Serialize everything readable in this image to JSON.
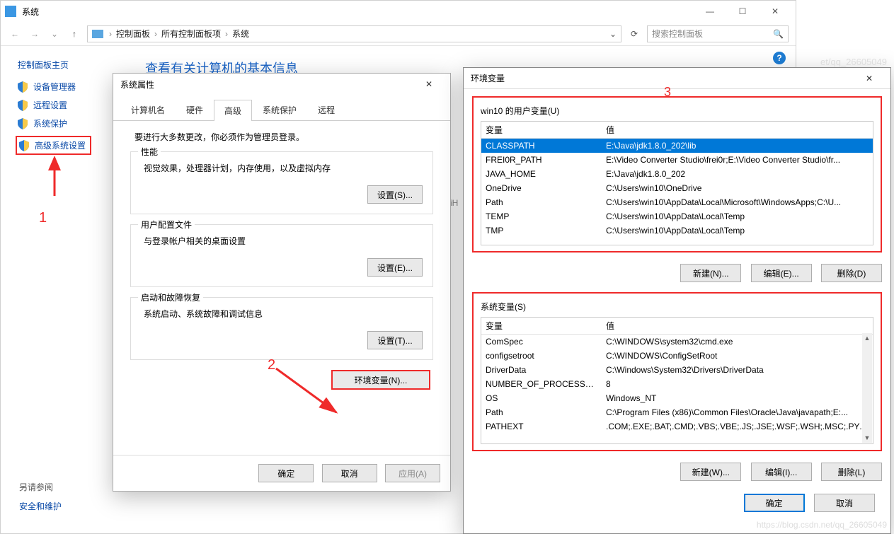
{
  "annotations": {
    "n1": "1",
    "n2": "2",
    "n3": "3"
  },
  "watermark": {
    "top": "et/qq_26605049",
    "bottom": "https://blog.csdn.net/qq_26605049"
  },
  "syswin": {
    "title": "系统",
    "min": "—",
    "max": "☐",
    "close": "✕",
    "nav_back": "←",
    "nav_fwd": "→",
    "nav_up": "↑",
    "breadcrumb": [
      "控制面板",
      "所有控制面板项",
      "系统"
    ],
    "addr_drop": "⌄",
    "refresh": "⟳",
    "search_placeholder": "搜索控制面板",
    "help": "?",
    "leftnav_title": "控制面板主页",
    "leftnav": [
      {
        "label": "设备管理器"
      },
      {
        "label": "远程设置"
      },
      {
        "label": "系统保护"
      },
      {
        "label": "高级系统设置",
        "hl": true
      }
    ],
    "content_h1": "查看有关计算机的基本信息",
    "middle_letter": "iH",
    "see_also": "另请参阅",
    "sec_link": "安全和维护"
  },
  "propdlg": {
    "title": "系统属性",
    "close": "✕",
    "tabs": [
      "计算机名",
      "硬件",
      "高级",
      "系统保护",
      "远程"
    ],
    "active_tab": 2,
    "admin_note": "要进行大多数更改，你必须作为管理员登录。",
    "groups": [
      {
        "title": "性能",
        "desc": "视觉效果，处理器计划，内存使用，以及虚拟内存",
        "btn": "设置(S)..."
      },
      {
        "title": "用户配置文件",
        "desc": "与登录帐户相关的桌面设置",
        "btn": "设置(E)..."
      },
      {
        "title": "启动和故障恢复",
        "desc": "系统启动、系统故障和调试信息",
        "btn": "设置(T)..."
      }
    ],
    "env_btn": "环境变量(N)...",
    "ok": "确定",
    "cancel": "取消",
    "apply": "应用(A)"
  },
  "envdlg": {
    "title": "环境变量",
    "close": "✕",
    "user_section_title": "win10 的用户变量(U)",
    "th_var": "变量",
    "th_val": "值",
    "user_vars": [
      {
        "name": "CLASSPATH",
        "value": "E:\\Java\\jdk1.8.0_202\\lib",
        "selected": true
      },
      {
        "name": "FREI0R_PATH",
        "value": "E:\\Video Converter Studio\\frei0r;E:\\Video Converter Studio\\fr..."
      },
      {
        "name": "JAVA_HOME",
        "value": "E:\\Java\\jdk1.8.0_202"
      },
      {
        "name": "OneDrive",
        "value": "C:\\Users\\win10\\OneDrive"
      },
      {
        "name": "Path",
        "value": "C:\\Users\\win10\\AppData\\Local\\Microsoft\\WindowsApps;C:\\U..."
      },
      {
        "name": "TEMP",
        "value": "C:\\Users\\win10\\AppData\\Local\\Temp"
      },
      {
        "name": "TMP",
        "value": "C:\\Users\\win10\\AppData\\Local\\Temp"
      }
    ],
    "user_new": "新建(N)...",
    "user_edit": "编辑(E)...",
    "user_del": "删除(D)",
    "sys_section_title": "系统变量(S)",
    "sys_vars": [
      {
        "name": "ComSpec",
        "value": "C:\\WINDOWS\\system32\\cmd.exe"
      },
      {
        "name": "configsetroot",
        "value": "C:\\WINDOWS\\ConfigSetRoot"
      },
      {
        "name": "DriverData",
        "value": "C:\\Windows\\System32\\Drivers\\DriverData"
      },
      {
        "name": "NUMBER_OF_PROCESSORS",
        "value": "8"
      },
      {
        "name": "OS",
        "value": "Windows_NT"
      },
      {
        "name": "Path",
        "value": "C:\\Program Files (x86)\\Common Files\\Oracle\\Java\\javapath;E:..."
      },
      {
        "name": "PATHEXT",
        "value": ".COM;.EXE;.BAT;.CMD;.VBS;.VBE;.JS;.JSE;.WSF;.WSH;.MSC;.PY;.P..."
      }
    ],
    "sys_new": "新建(W)...",
    "sys_edit": "编辑(I)...",
    "sys_del": "删除(L)",
    "ok": "确定",
    "cancel": "取消",
    "scroll_up": "▲",
    "scroll_down": "▼"
  }
}
